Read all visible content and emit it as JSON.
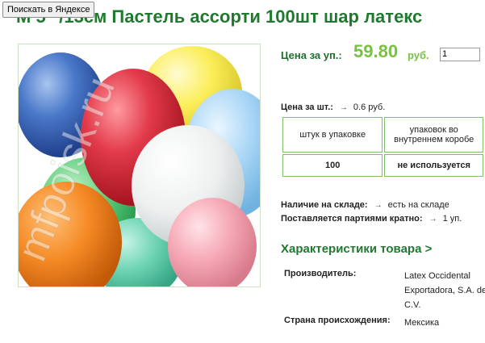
{
  "yandex_button": "Поискать в Яндексе",
  "product": {
    "title": "М 5\" /13см Пастель ассорти 100шт шар латекс",
    "image_watermark": "mfpoisk.ru"
  },
  "price": {
    "label": "Цена за уп.:",
    "value": "59.80",
    "currency": "руб.",
    "quantity": "1"
  },
  "unit_price": {
    "label": "Цена за шт.:",
    "value": "0.6 руб."
  },
  "packaging": {
    "headers": [
      "штук в упаковке",
      "упаковок во внутреннем коробе"
    ],
    "values": [
      "100",
      "не используется"
    ]
  },
  "stock": {
    "label": "Наличие на складе:",
    "value": "есть на складе"
  },
  "batch": {
    "label": "Поставляется партиями кратно:",
    "value": "1 уп."
  },
  "specs": {
    "link_label": "Характеристики товара >",
    "rows": [
      {
        "key": "Производитель:",
        "value": "Latex Occidental Exportadora, S.A. de C.V."
      },
      {
        "key": "Страна происхождения:",
        "value": "Мексика"
      }
    ]
  },
  "colors": {
    "title_green": "#1f7a2f",
    "price_green": "#7ac043",
    "border_green": "#7fbf6b"
  }
}
